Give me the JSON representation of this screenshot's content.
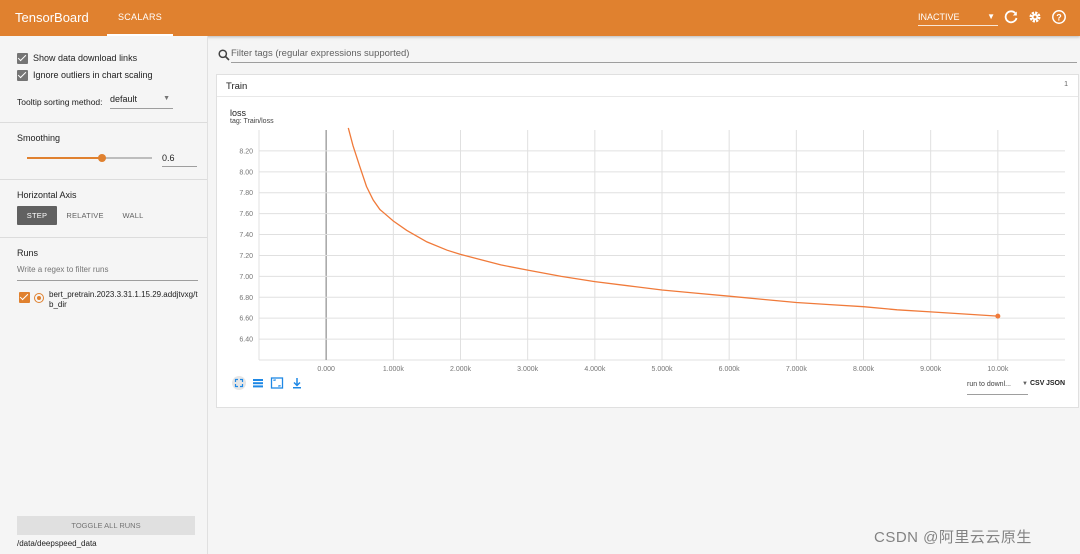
{
  "header": {
    "brand": "TensorBoard",
    "tab": "SCALARS",
    "status_select": "INACTIVE",
    "icons": [
      "refresh-icon",
      "settings-icon",
      "help-icon"
    ]
  },
  "sidebar": {
    "show_download_links": "Show data download links",
    "ignore_outliers": "Ignore outliers in chart scaling",
    "tooltip_sorting_label": "Tooltip sorting method:",
    "tooltip_sorting_value": "default",
    "smoothing_label": "Smoothing",
    "smoothing_value": "0.6",
    "smoothing_fraction": 0.6,
    "horizontal_axis_label": "Horizontal Axis",
    "axis_step": "STEP",
    "axis_relative": "RELATIVE",
    "axis_wall": "WALL",
    "runs_label": "Runs",
    "runs_filter_placeholder": "Write a regex to filter runs",
    "run_name": "bert_pretrain.2023.3.31.1.15.29.addjtvxg/tb_dir",
    "toggle_all_runs": "TOGGLE ALL RUNS",
    "logdir": "/data/deepspeed_data"
  },
  "main": {
    "filter_placeholder": "Filter tags (regular expressions supported)",
    "pane_title": "Train",
    "pane_count": "1",
    "chart_title": "loss",
    "chart_tag": "tag: Train/loss",
    "run_select": "run to downl...",
    "csv": "CSV",
    "json": "JSON"
  },
  "colors": {
    "accent": "#e0812f",
    "grid": "#e0e0e0",
    "series": "#f07a3a"
  },
  "watermark": "CSDN @阿里云云原生",
  "chart_data": {
    "type": "line",
    "title": "loss",
    "subtitle": "tag: Train/loss",
    "xlabel": "",
    "ylabel": "",
    "xlim": [
      -1000,
      11000
    ],
    "ylim": [
      6.2,
      8.4
    ],
    "xticks": [
      0,
      1000,
      2000,
      3000,
      4000,
      5000,
      6000,
      7000,
      8000,
      9000,
      10000
    ],
    "xtick_labels": [
      "0.000",
      "1.000k",
      "2.000k",
      "3.000k",
      "4.000k",
      "5.000k",
      "6.000k",
      "7.000k",
      "8.000k",
      "9.000k",
      "10.00k"
    ],
    "yticks": [
      6.4,
      6.6,
      6.8,
      7.0,
      7.2,
      7.4,
      7.6,
      7.8,
      8.0,
      8.2
    ],
    "ytick_labels": [
      "6.40",
      "6.60",
      "6.80",
      "7.00",
      "7.20",
      "7.40",
      "7.60",
      "7.80",
      "8.00",
      "8.20"
    ],
    "grid": true,
    "series": [
      {
        "x": [
          330,
          400,
          500,
          600,
          700,
          800,
          1000,
          1200,
          1500,
          1800,
          2000,
          2300,
          2600,
          3000,
          3500,
          4000,
          4500,
          5000,
          5500,
          6000,
          6500,
          7000,
          7500,
          8000,
          8500,
          9000,
          9500,
          10000
        ],
        "y": [
          8.42,
          8.25,
          8.05,
          7.86,
          7.73,
          7.64,
          7.53,
          7.44,
          7.33,
          7.25,
          7.21,
          7.16,
          7.11,
          7.06,
          7.0,
          6.95,
          6.91,
          6.87,
          6.84,
          6.81,
          6.78,
          6.75,
          6.73,
          6.71,
          6.68,
          6.66,
          6.64,
          6.62
        ]
      }
    ]
  }
}
